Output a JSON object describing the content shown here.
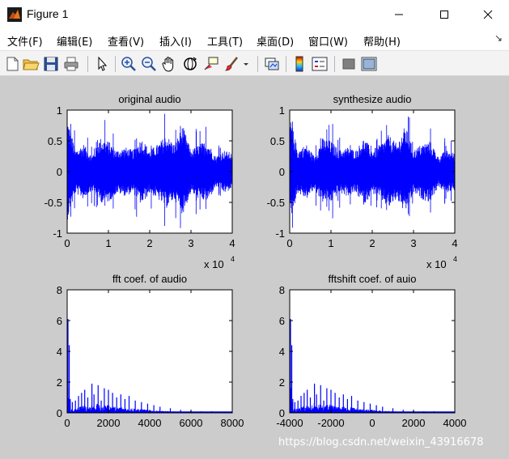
{
  "window": {
    "title": "Figure 1",
    "controls": {
      "minimize_icon": "minimize-icon",
      "maximize_icon": "maximize-icon",
      "close_icon": "close-icon"
    }
  },
  "menubar": {
    "items": [
      {
        "label": "文件(F)"
      },
      {
        "label": "编辑(E)"
      },
      {
        "label": "查看(V)"
      },
      {
        "label": "插入(I)"
      },
      {
        "label": "工具(T)"
      },
      {
        "label": "桌面(D)"
      },
      {
        "label": "窗口(W)"
      },
      {
        "label": "帮助(H)"
      }
    ],
    "overflow_icon": "dock-arrow-icon"
  },
  "toolbar": {
    "buttons": [
      "new-figure-icon",
      "open-file-icon",
      "save-icon",
      "print-icon",
      "pointer-icon",
      "zoom-in-icon",
      "zoom-out-icon",
      "pan-hand-icon",
      "rotate-3d-icon",
      "data-cursor-icon",
      "brush-icon",
      "brush-dropdown-icon",
      "link-plot-icon",
      "colorbar-icon",
      "legend-icon",
      "hide-plot-tools-icon",
      "show-plot-tools-icon"
    ]
  },
  "colors": {
    "figure_bg": "#cccccc",
    "axes_bg": "#ffffff",
    "line": "#0000ff"
  },
  "watermark": "https://blog.csdn.net/weixin_43916678",
  "chart_data": [
    {
      "type": "line",
      "title": "original audio",
      "xlim": [
        0,
        40000
      ],
      "ylim": [
        -1,
        1
      ],
      "xticks": [
        0,
        1,
        2,
        3,
        4
      ],
      "yticks": [
        -1,
        -0.5,
        0,
        0.5,
        1
      ],
      "xtick_labels": [
        "0",
        "1",
        "2",
        "3",
        "4"
      ],
      "ytick_labels": [
        "-1",
        "-0.5",
        "0",
        "0.5",
        "1"
      ],
      "x_exponent_label": "x 10",
      "x_exponent": "4",
      "series_envelope": {
        "x": [
          0,
          2000,
          4000,
          6000,
          8000,
          10000,
          12000,
          14000,
          16000,
          18000,
          20000,
          22000,
          24000,
          26000,
          28000,
          30000,
          32000,
          34000,
          36000,
          38000,
          40000
        ],
        "upper": [
          0.9,
          0.35,
          0.45,
          0.25,
          0.55,
          0.5,
          0.35,
          0.4,
          0.35,
          0.55,
          0.35,
          0.45,
          0.6,
          0.45,
          0.75,
          0.35,
          0.45,
          0.5,
          0.25,
          0.35,
          0.3
        ],
        "lower": [
          -0.8,
          -0.35,
          -0.45,
          -0.3,
          -0.5,
          -0.5,
          -0.35,
          -0.4,
          -0.35,
          -0.55,
          -0.35,
          -0.45,
          -0.6,
          -0.45,
          -0.7,
          -0.35,
          -0.45,
          -0.5,
          -0.25,
          -0.35,
          -0.3
        ]
      }
    },
    {
      "type": "line",
      "title": "synthesize audio",
      "xlim": [
        0,
        40000
      ],
      "ylim": [
        -1,
        1
      ],
      "xticks": [
        0,
        1,
        2,
        3,
        4
      ],
      "yticks": [
        -1,
        -0.5,
        0,
        0.5,
        1
      ],
      "xtick_labels": [
        "0",
        "1",
        "2",
        "3",
        "4"
      ],
      "ytick_labels": [
        "-1",
        "-0.5",
        "0",
        "0.5",
        "1"
      ],
      "x_exponent_label": "x 10",
      "x_exponent": "4",
      "series_envelope": {
        "x": [
          0,
          2000,
          4000,
          6000,
          8000,
          10000,
          12000,
          14000,
          16000,
          18000,
          20000,
          22000,
          24000,
          26000,
          28000,
          30000,
          32000,
          34000,
          36000,
          38000,
          40000
        ],
        "upper": [
          0.9,
          0.35,
          0.45,
          0.25,
          0.55,
          0.5,
          0.35,
          0.4,
          0.35,
          0.55,
          0.35,
          0.45,
          0.6,
          0.45,
          0.75,
          0.35,
          0.45,
          0.5,
          0.25,
          0.35,
          0.3
        ],
        "lower": [
          -0.8,
          -0.35,
          -0.45,
          -0.3,
          -0.5,
          -0.5,
          -0.35,
          -0.4,
          -0.35,
          -0.55,
          -0.35,
          -0.45,
          -0.6,
          -0.45,
          -0.7,
          -0.35,
          -0.45,
          -0.5,
          -0.25,
          -0.35,
          -0.3
        ]
      }
    },
    {
      "type": "line",
      "title": "fft coef. of audio",
      "xlim": [
        0,
        8000
      ],
      "ylim": [
        0,
        8
      ],
      "xticks": [
        0,
        2000,
        4000,
        6000,
        8000
      ],
      "yticks": [
        0,
        2,
        4,
        6,
        8
      ],
      "xtick_labels": [
        "0",
        "2000",
        "4000",
        "6000",
        "8000"
      ],
      "ytick_labels": [
        "0",
        "2",
        "4",
        "6",
        "8"
      ],
      "peaks": {
        "x": [
          0,
          100,
          150,
          250,
          400,
          550,
          700,
          850,
          1000,
          1200,
          1300,
          1500,
          1650,
          1800,
          2000,
          2200,
          2400,
          2600,
          2800,
          3000,
          3300,
          3600,
          3900,
          4200,
          4500,
          5000,
          5500,
          6000,
          6500,
          7000,
          7500,
          8000
        ],
        "y": [
          6.1,
          4.4,
          0.9,
          0.7,
          0.8,
          1.1,
          1.3,
          1.5,
          1.0,
          1.9,
          1.2,
          1.8,
          0.8,
          1.6,
          1.5,
          1.3,
          1.0,
          1.2,
          0.9,
          1.1,
          0.8,
          0.7,
          0.6,
          0.5,
          0.4,
          0.3,
          0.2,
          0.15,
          0.1,
          0.1,
          0.05,
          0.05
        ]
      }
    },
    {
      "type": "line",
      "title": "fftshift coef. of auio",
      "xlim": [
        -4000,
        4000
      ],
      "ylim": [
        0,
        8
      ],
      "xticks": [
        -4000,
        -2000,
        0,
        2000,
        4000
      ],
      "yticks": [
        0,
        2,
        4,
        6,
        8
      ],
      "xtick_labels": [
        "-4000",
        "-2000",
        "0",
        "2000",
        "4000"
      ],
      "ytick_labels": [
        "0",
        "2",
        "4",
        "6",
        "8"
      ],
      "peaks": {
        "x": [
          -4000,
          -3900,
          -3850,
          -3750,
          -3600,
          -3450,
          -3300,
          -3150,
          -3000,
          -2800,
          -2700,
          -2500,
          -2350,
          -2200,
          -2000,
          -1800,
          -1600,
          -1400,
          -1200,
          -1000,
          -700,
          -400,
          -100,
          200,
          500,
          1000,
          1500,
          2000,
          2500,
          3000,
          3500,
          4000
        ],
        "y": [
          6.1,
          4.4,
          0.9,
          0.7,
          0.8,
          1.1,
          1.3,
          1.5,
          1.0,
          1.9,
          1.2,
          1.8,
          0.8,
          1.6,
          1.5,
          1.3,
          1.0,
          1.2,
          0.9,
          1.1,
          0.8,
          0.7,
          0.6,
          0.5,
          0.4,
          0.3,
          0.2,
          0.15,
          0.1,
          0.1,
          0.05,
          0.05
        ]
      }
    }
  ]
}
